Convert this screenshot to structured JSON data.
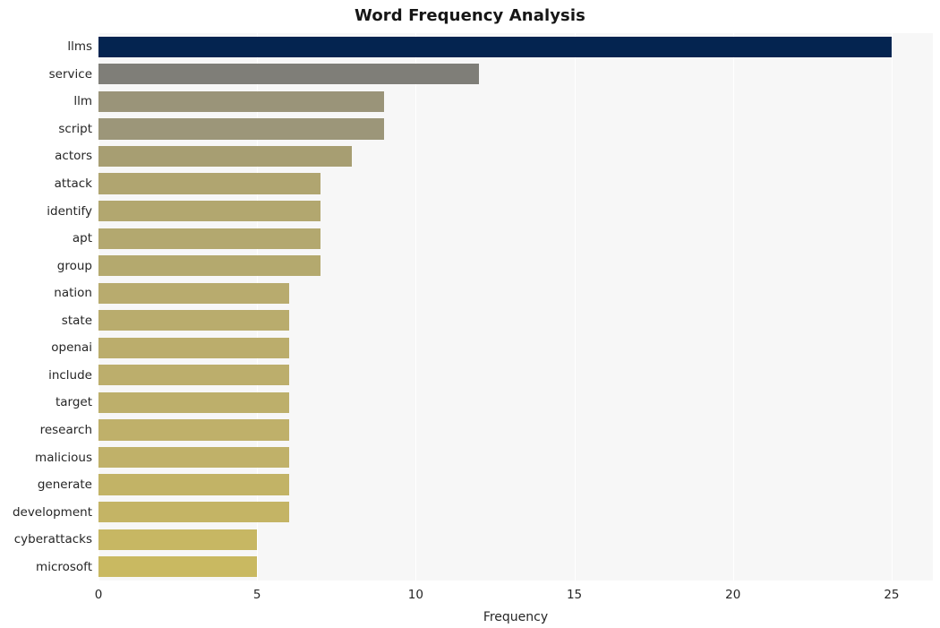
{
  "chart_data": {
    "type": "bar",
    "orientation": "horizontal",
    "title": "Word Frequency Analysis",
    "xlabel": "Frequency",
    "ylabel": "",
    "xlim": [
      0,
      26.3
    ],
    "xticks": [
      "0",
      "5",
      "10",
      "15",
      "20",
      "25"
    ],
    "xtick_values": [
      0,
      5,
      10,
      15,
      20,
      25
    ],
    "grid": "vertical-white",
    "legend": "none",
    "categories": [
      "llms",
      "service",
      "llm",
      "script",
      "actors",
      "attack",
      "identify",
      "apt",
      "group",
      "nation",
      "state",
      "openai",
      "include",
      "target",
      "research",
      "malicious",
      "generate",
      "development",
      "cyberattacks",
      "microsoft"
    ],
    "values": [
      25,
      12,
      9,
      9,
      8,
      7,
      7,
      7,
      7,
      6,
      6,
      6,
      6,
      6,
      6,
      6,
      6,
      6,
      5,
      5
    ],
    "bar_colors": [
      "#042450",
      "#7f7e78",
      "#9a9479",
      "#9c9679",
      "#a79e72",
      "#b0a570",
      "#b2a76f",
      "#b3a86f",
      "#b4a96e",
      "#b8ab6e",
      "#b9ac6d",
      "#bbad6c",
      "#bcae6c",
      "#bdaf6b",
      "#bfb06a",
      "#c0b169",
      "#c2b366",
      "#c4b465",
      "#c7b763",
      "#c9b961"
    ],
    "plot_background": "#f7f7f7",
    "figure_background": "#ffffff",
    "gridline_color": "#ffffff",
    "text_color": "#262626"
  }
}
